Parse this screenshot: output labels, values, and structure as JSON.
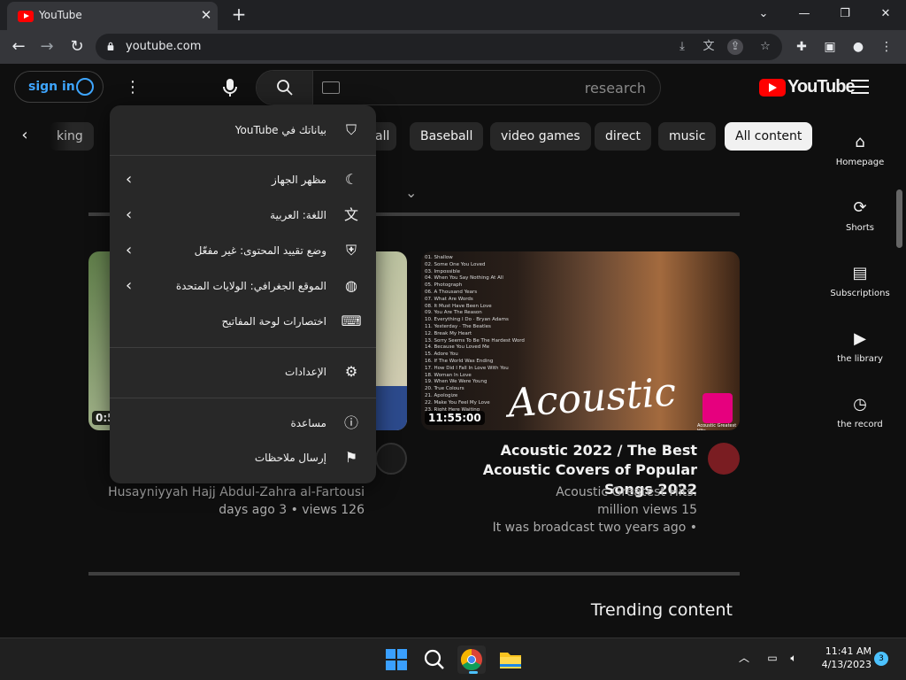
{
  "browser": {
    "tab_title": "YouTube",
    "url": "youtube.com",
    "icons": {
      "back": "arrow-left-icon",
      "forward": "arrow-right-icon",
      "reload": "reload-icon",
      "extensions": "puzzle-icon",
      "sidepanel": "side-panel-icon",
      "profile": "profile-icon",
      "menu": "kebab-icon"
    }
  },
  "header": {
    "sign_in": "sign in",
    "search_placeholder": "research",
    "logo_text": "YouTube",
    "brand_color": "#ff0000",
    "accent_color": "#3ea6ff"
  },
  "chips": [
    "king",
    "all",
    "Baseball",
    "video games",
    "direct",
    "music",
    "All content"
  ],
  "active_chip": "All content",
  "guide": [
    {
      "label": "Homepage",
      "icon": "home-icon"
    },
    {
      "label": "Shorts",
      "icon": "shorts-icon"
    },
    {
      "label": "Subscriptions",
      "icon": "subscriptions-icon"
    },
    {
      "label": "the library",
      "icon": "library-icon"
    },
    {
      "label": "the record",
      "icon": "history-icon"
    }
  ],
  "menu": {
    "your_data": "بياناتك في YouTube",
    "appearance": "مظهر الجهاز",
    "language": "اللغة: العربية",
    "restricted": "وضع تقييد المحتوى: غير مفعّل",
    "location": "الموقع الجغرافي: الولايات المتحدة",
    "shortcuts": "اختصارات لوحة المفاتيح",
    "settings": "الإعدادات",
    "help": "مساعدة",
    "feedback": "إرسال ملاحظات"
  },
  "videos": [
    {
      "duration": "0:5",
      "channel": "Husayniyyah Hajj Abdul-Zahra al-Fartousi",
      "meta": "days ago 3 • views 126"
    },
    {
      "duration": "11:55:00",
      "title": "Acoustic 2022 / The Best Acoustic Covers of Popular Songs 2022",
      "channel": "Acoustic Greatest Hits.",
      "views": "million views 15",
      "broadcast": "It was broadcast two years ago •",
      "thumb_script": "Acoustic",
      "thumb_brand": "Acoustic Greatest Hits",
      "tracklist": [
        "01. Shallow",
        "02. Some One You Loved",
        "03. Impossible",
        "04. When You Say Nothing At All",
        "05. Photograph",
        "06. A Thousand Years",
        "07. What Are Words",
        "08. It Must Have Been Love",
        "09. You Are The Reason",
        "10. Everything I Do · Bryan Adams",
        "11. Yesterday · The Beatles",
        "12. Break My Heart",
        "13. Sorry Seems To Be The Hardest Word",
        "14. Because You Loved Me",
        "15. Adore You",
        "16. If The World Was Ending",
        "17. How Did I Fall In Love With You",
        "18. Woman In Love",
        "19. When We Were Young",
        "20. True Colours",
        "21. Apologize",
        "22. Make You Feel My Love",
        "23. Right Here Waiting"
      ]
    }
  ],
  "section_title": "Trending content",
  "taskbar": {
    "time": "11:41 AM",
    "date": "4/13/2023",
    "notifications": "3"
  }
}
